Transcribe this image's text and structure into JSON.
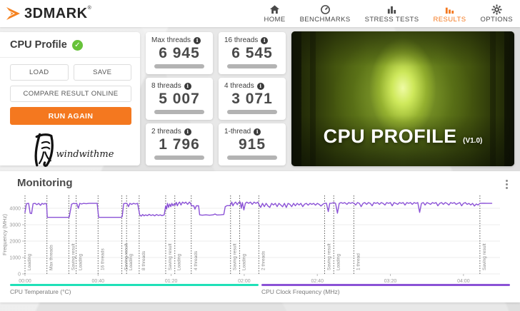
{
  "header": {
    "logo_text": "3DMARK",
    "logo_reg": "®",
    "nav": [
      {
        "label": "HOME",
        "icon": "home-icon",
        "active": false
      },
      {
        "label": "BENCHMARKS",
        "icon": "gauge-icon",
        "active": false
      },
      {
        "label": "STRESS TESTS",
        "icon": "bar-chart-icon",
        "active": false
      },
      {
        "label": "RESULTS",
        "icon": "bar-chart-icon",
        "active": true
      },
      {
        "label": "OPTIONS",
        "icon": "gear-icon",
        "active": false
      }
    ]
  },
  "result_panel": {
    "title": "CPU Profile",
    "check_glyph": "✓",
    "buttons": {
      "load": "LOAD",
      "save": "SAVE",
      "compare": "COMPARE RESULT ONLINE",
      "run_again": "RUN AGAIN"
    },
    "watermark_text": "windwithme"
  },
  "scores": {
    "info_glyph": "i",
    "cards": [
      {
        "label": "Max threads",
        "value": "6 945"
      },
      {
        "label": "16 threads",
        "value": "6 545"
      },
      {
        "label": "8 threads",
        "value": "5 007"
      },
      {
        "label": "4 threads",
        "value": "3 071"
      },
      {
        "label": "2 threads",
        "value": "1 796"
      },
      {
        "label": "1-thread",
        "value": "915"
      }
    ]
  },
  "hero": {
    "title": "CPU PROFILE",
    "version": "(V1.0)"
  },
  "monitoring": {
    "title": "Monitoring"
  },
  "colors": {
    "accent_orange": "#f4781f",
    "line_purple": "#8b52d6",
    "legend_teal": "#1fe0b8",
    "check_green": "#67c23a"
  },
  "chart_data": {
    "type": "line",
    "title": "Monitoring",
    "ylabel": "Frequency (MHz)",
    "yticks": [
      0,
      1000,
      2000,
      3000,
      4000
    ],
    "ylim": [
      0,
      4800
    ],
    "xlim_s": [
      0,
      260
    ],
    "grid": true,
    "legend_position": "bottom",
    "xticks": [
      {
        "t": 0,
        "label": "00:00"
      },
      {
        "t": 40,
        "label": "00:40"
      },
      {
        "t": 80,
        "label": "01:20"
      },
      {
        "t": 120,
        "label": "02:00"
      },
      {
        "t": 160,
        "label": "02:40"
      },
      {
        "t": 200,
        "label": "03:20"
      },
      {
        "t": 240,
        "label": "04:00"
      }
    ],
    "phases": [
      {
        "t": 0,
        "label": "Loading"
      },
      {
        "t": 12,
        "label": "Max threads"
      },
      {
        "t": 24,
        "label": "Saving result"
      },
      {
        "t": 28,
        "label": "Loading"
      },
      {
        "t": 40,
        "label": "16 threads"
      },
      {
        "t": 53,
        "label": "Saving result"
      },
      {
        "t": 55.6,
        "label": "Loading"
      },
      {
        "t": 62.5,
        "label": "8 threads"
      },
      {
        "t": 77,
        "label": "Saving result"
      },
      {
        "t": 82,
        "label": "Loading"
      },
      {
        "t": 91,
        "label": "4 threads"
      },
      {
        "t": 112.5,
        "label": "Saving result"
      },
      {
        "t": 117.5,
        "label": "Loading"
      },
      {
        "t": 128,
        "label": "2 threads"
      },
      {
        "t": 164,
        "label": "Saving result"
      },
      {
        "t": 169,
        "label": "Loading"
      },
      {
        "t": 180,
        "label": "1 thread"
      },
      {
        "t": 249,
        "label": "Saving result"
      }
    ],
    "legend": [
      {
        "label": "CPU Temperature (°C)",
        "color": "#1fe0b8"
      },
      {
        "label": "CPU Clock Frequency (MHz)",
        "color": "#8b52d6"
      }
    ],
    "series": [
      {
        "name": "CPU Clock Frequency (MHz)",
        "color": "#8b52d6",
        "points": [
          [
            0,
            3750
          ],
          [
            0.8,
            4280
          ],
          [
            2,
            4300
          ],
          [
            2.8,
            3700
          ],
          [
            3.6,
            3680
          ],
          [
            4.4,
            4280
          ],
          [
            5.5,
            4300
          ],
          [
            6.5,
            4220
          ],
          [
            7.5,
            4300
          ],
          [
            8.5,
            4180
          ],
          [
            9.3,
            4300
          ],
          [
            10.2,
            4250
          ],
          [
            11,
            4300
          ],
          [
            11.8,
            4250
          ],
          [
            12.2,
            3450
          ],
          [
            23.6,
            3450
          ],
          [
            24.2,
            3460
          ],
          [
            25.5,
            4250
          ],
          [
            26.5,
            4300
          ],
          [
            27.5,
            4280
          ],
          [
            28.3,
            4300
          ],
          [
            29.2,
            4000
          ],
          [
            30,
            4300
          ],
          [
            31,
            4260
          ],
          [
            32,
            4300
          ],
          [
            33.5,
            4280
          ],
          [
            35,
            4300
          ],
          [
            37,
            4300
          ],
          [
            39.5,
            4300
          ],
          [
            40.3,
            3450
          ],
          [
            52.6,
            3450
          ],
          [
            53.2,
            3500
          ],
          [
            54,
            4280
          ],
          [
            55,
            4300
          ],
          [
            55.8,
            4300
          ],
          [
            56.6,
            4100
          ],
          [
            57.4,
            4300
          ],
          [
            58.4,
            4240
          ],
          [
            59.4,
            4300
          ],
          [
            60.5,
            4260
          ],
          [
            61.6,
            4300
          ],
          [
            62.8,
            3600
          ],
          [
            63.6,
            3520
          ],
          [
            64.4,
            3620
          ],
          [
            65.2,
            3540
          ],
          [
            66,
            3600
          ],
          [
            67,
            3550
          ],
          [
            68,
            3630
          ],
          [
            69,
            3560
          ],
          [
            70,
            3610
          ],
          [
            71,
            3540
          ],
          [
            72,
            3620
          ],
          [
            73,
            3560
          ],
          [
            74,
            3600
          ],
          [
            75,
            3550
          ],
          [
            76.2,
            3600
          ],
          [
            77,
            4150
          ],
          [
            77.5,
            3950
          ],
          [
            78,
            4300
          ],
          [
            78.6,
            4050
          ],
          [
            79.2,
            4260
          ],
          [
            79.8,
            4100
          ],
          [
            80.4,
            4300
          ],
          [
            81,
            4150
          ],
          [
            81.6,
            4260
          ],
          [
            82.2,
            4200
          ],
          [
            82.8,
            4360
          ],
          [
            83.4,
            4150
          ],
          [
            84,
            4300
          ],
          [
            84.6,
            4380
          ],
          [
            85.4,
            4200
          ],
          [
            86.2,
            4380
          ],
          [
            87.2,
            4300
          ],
          [
            88,
            4380
          ],
          [
            89,
            4240
          ],
          [
            90,
            4380
          ],
          [
            90.6,
            4300
          ],
          [
            91.2,
            4150
          ],
          [
            92.4,
            4150
          ],
          [
            93,
            3950
          ],
          [
            93.8,
            4150
          ],
          [
            95,
            4150
          ],
          [
            95.6,
            3600
          ],
          [
            97,
            3580
          ],
          [
            99,
            3600
          ],
          [
            101,
            3580
          ],
          [
            103,
            3600
          ],
          [
            104,
            3650
          ],
          [
            105,
            3590
          ],
          [
            107,
            3600
          ],
          [
            108.8,
            3620
          ],
          [
            109.6,
            4100
          ],
          [
            110.6,
            4160
          ],
          [
            112,
            4160
          ],
          [
            112.6,
            4220
          ],
          [
            113.2,
            4380
          ],
          [
            113.8,
            4150
          ],
          [
            114.5,
            4300
          ],
          [
            115.3,
            4380
          ],
          [
            116.2,
            4220
          ],
          [
            117,
            4360
          ],
          [
            117.8,
            4380
          ],
          [
            118.4,
            4000
          ],
          [
            119,
            4350
          ],
          [
            119.8,
            3900
          ],
          [
            120.6,
            4300
          ],
          [
            121.4,
            4380
          ],
          [
            122.4,
            4300
          ],
          [
            123.4,
            4380
          ],
          [
            124.4,
            4240
          ],
          [
            125.4,
            4380
          ],
          [
            126.4,
            4300
          ],
          [
            127.4,
            4380
          ],
          [
            128.2,
            4200
          ],
          [
            129,
            4050
          ],
          [
            130,
            4300
          ],
          [
            131,
            4100
          ],
          [
            132,
            4300
          ],
          [
            133,
            4140
          ],
          [
            134,
            4050
          ],
          [
            135,
            4300
          ],
          [
            136,
            4200
          ],
          [
            137,
            4300
          ],
          [
            138,
            4100
          ],
          [
            139,
            4300
          ],
          [
            140,
            4200
          ],
          [
            141,
            4090
          ],
          [
            142,
            4300
          ],
          [
            143,
            4050
          ],
          [
            144,
            4300
          ],
          [
            145,
            4240
          ],
          [
            146,
            4100
          ],
          [
            147,
            4300
          ],
          [
            148,
            4150
          ],
          [
            149,
            4300
          ],
          [
            150,
            4200
          ],
          [
            151,
            4300
          ],
          [
            152,
            4100
          ],
          [
            153,
            4250
          ],
          [
            154,
            4300
          ],
          [
            155,
            4190
          ],
          [
            156,
            4300
          ],
          [
            157,
            4240
          ],
          [
            158,
            4300
          ],
          [
            159,
            4190
          ],
          [
            160,
            4300
          ],
          [
            161,
            4240
          ],
          [
            162,
            4140
          ],
          [
            163.2,
            4260
          ],
          [
            164,
            4300
          ],
          [
            165,
            4310
          ],
          [
            166,
            3800
          ],
          [
            166.8,
            4300
          ],
          [
            168,
            4310
          ],
          [
            169,
            4350
          ],
          [
            170,
            4300
          ],
          [
            171,
            3700
          ],
          [
            172,
            4300
          ],
          [
            173,
            4350
          ],
          [
            174,
            4300
          ],
          [
            175,
            4350
          ],
          [
            176.2,
            4240
          ],
          [
            177.2,
            4350
          ],
          [
            178.2,
            4300
          ],
          [
            179.2,
            4350
          ],
          [
            180.2,
            4300
          ],
          [
            181,
            4200
          ],
          [
            182,
            4350
          ],
          [
            183,
            4300
          ],
          [
            184,
            4100
          ],
          [
            185,
            4300
          ],
          [
            186,
            4350
          ],
          [
            187,
            4240
          ],
          [
            188,
            4350
          ],
          [
            189,
            4300
          ],
          [
            190,
            4150
          ],
          [
            191,
            4350
          ],
          [
            192,
            4300
          ],
          [
            193,
            4350
          ],
          [
            194,
            4240
          ],
          [
            195,
            4350
          ],
          [
            196,
            4300
          ],
          [
            197,
            4200
          ],
          [
            198,
            4350
          ],
          [
            199,
            4300
          ],
          [
            200,
            4350
          ],
          [
            201,
            4150
          ],
          [
            202,
            4350
          ],
          [
            203,
            4300
          ],
          [
            204,
            4240
          ],
          [
            205,
            4350
          ],
          [
            206,
            4300
          ],
          [
            207,
            4350
          ],
          [
            208,
            4200
          ],
          [
            209,
            4350
          ],
          [
            210,
            4300
          ],
          [
            211,
            4350
          ],
          [
            212,
            4240
          ],
          [
            213,
            4350
          ],
          [
            214,
            4300
          ],
          [
            215,
            4350
          ],
          [
            216,
            3750
          ],
          [
            217,
            4300
          ],
          [
            218,
            4350
          ],
          [
            219,
            4200
          ],
          [
            220,
            4350
          ],
          [
            221,
            4300
          ],
          [
            222,
            4240
          ],
          [
            223,
            4350
          ],
          [
            224,
            4300
          ],
          [
            225,
            4350
          ],
          [
            226,
            4150
          ],
          [
            227,
            4300
          ],
          [
            228,
            4350
          ],
          [
            229,
            4240
          ],
          [
            230,
            4350
          ],
          [
            231,
            4300
          ],
          [
            232,
            4200
          ],
          [
            233,
            4350
          ],
          [
            234,
            4300
          ],
          [
            235,
            4350
          ],
          [
            236,
            4240
          ],
          [
            237,
            4300
          ],
          [
            238,
            4350
          ],
          [
            239,
            4150
          ],
          [
            240,
            4300
          ],
          [
            241,
            4350
          ],
          [
            242,
            4240
          ],
          [
            243,
            4300
          ],
          [
            244,
            4200
          ],
          [
            245,
            4300
          ],
          [
            246,
            4140
          ],
          [
            247,
            4260
          ],
          [
            248,
            4200
          ],
          [
            249,
            4300
          ],
          [
            251,
            4305
          ],
          [
            253,
            4300
          ],
          [
            255.5,
            4300
          ]
        ]
      }
    ]
  }
}
